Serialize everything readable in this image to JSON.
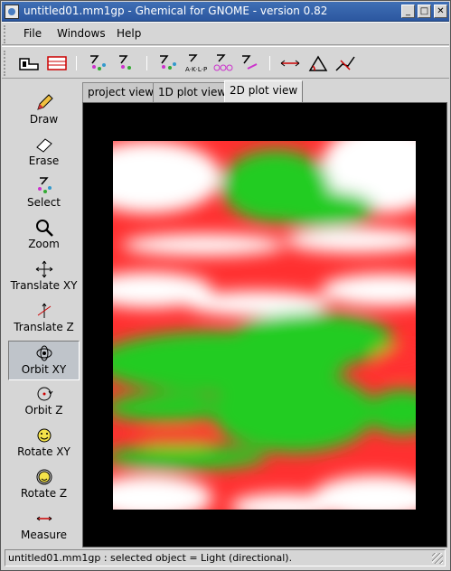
{
  "window": {
    "title": "untitled01.mm1gp - Ghemical for GNOME - version 0.82",
    "buttons": {
      "minimize": "_",
      "maximize": "□",
      "close": "✕"
    }
  },
  "menu": {
    "items": [
      {
        "label": "File"
      },
      {
        "label": "Windows"
      },
      {
        "label": "Help"
      }
    ]
  },
  "toolbar": {
    "icons": [
      "new-file-icon",
      "element-table-icon",
      "select-atoms-icon",
      "select-residue-icon",
      "select-chain-icon",
      "select-molecule-icon",
      "select-ring-icon",
      "bond-icon",
      "measure-distance-icon",
      "measure-angle-icon",
      "measure-torsion-icon"
    ]
  },
  "toolbox": {
    "tools": [
      {
        "label": "Draw",
        "icon": "pencil-icon",
        "active": false
      },
      {
        "label": "Erase",
        "icon": "eraser-icon",
        "active": false
      },
      {
        "label": "Select",
        "icon": "select-icon",
        "active": false
      },
      {
        "label": "Zoom",
        "icon": "magnifier-icon",
        "active": false
      },
      {
        "label": "Translate XY",
        "icon": "translate-xy-icon",
        "active": false
      },
      {
        "label": "Translate Z",
        "icon": "translate-z-icon",
        "active": false
      },
      {
        "label": "Orbit XY",
        "icon": "orbit-xy-icon",
        "active": true
      },
      {
        "label": "Orbit Z",
        "icon": "orbit-z-icon",
        "active": false
      },
      {
        "label": "Rotate XY",
        "icon": "rotate-xy-icon",
        "active": false
      },
      {
        "label": "Rotate Z",
        "icon": "rotate-z-icon",
        "active": false
      },
      {
        "label": "Measure",
        "icon": "measure-icon",
        "active": false
      }
    ]
  },
  "tabs": [
    {
      "label": "project view",
      "active": false
    },
    {
      "label": "1D plot view",
      "active": false
    },
    {
      "label": "2D plot view",
      "active": true
    }
  ],
  "status": {
    "text": "untitled01.mm1gp : selected object = Light (directional)."
  },
  "colors": {
    "title_bar": "#3060a8",
    "plot_high": "#ff0000",
    "plot_low": "#00cc00",
    "plot_mid": "#ffffff",
    "viewport_bg": "#000000"
  }
}
